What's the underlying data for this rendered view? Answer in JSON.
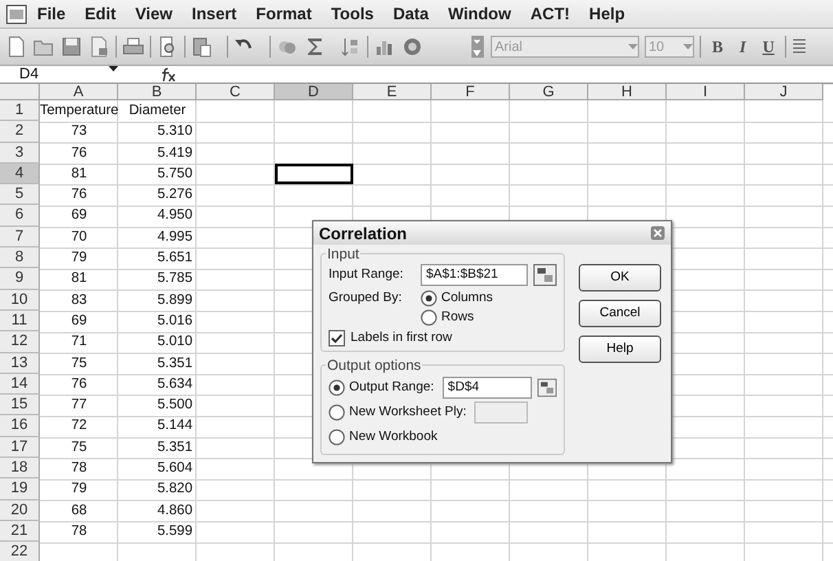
{
  "menu_bar": {
    "items": [
      "File",
      "Edit",
      "View",
      "Insert",
      "Format",
      "Tools",
      "Data",
      "Window",
      "ACT!",
      "Help"
    ]
  },
  "formatting_toolbar": {
    "font": "Arial",
    "size": "10",
    "buttons": [
      "B",
      "I",
      "U"
    ]
  },
  "formula_bar": {
    "name_box": "D4"
  },
  "sheet": {
    "columns": [
      {
        "label": "A",
        "selected": false
      },
      {
        "label": "B",
        "selected": false
      },
      {
        "label": "C",
        "selected": false
      },
      {
        "label": "D",
        "selected": true
      },
      {
        "label": "E",
        "selected": false
      },
      {
        "label": "F",
        "selected": false
      },
      {
        "label": "G",
        "selected": false
      },
      {
        "label": "H",
        "selected": false
      },
      {
        "label": "I",
        "selected": false
      },
      {
        "label": "J",
        "selected": false
      }
    ],
    "rows": [
      {
        "number": "1",
        "selected": false,
        "cells": [
          "Temperature",
          "Diameter"
        ]
      },
      {
        "number": "2",
        "selected": false,
        "cells": [
          "73",
          "5.310"
        ]
      },
      {
        "number": "3",
        "selected": false,
        "cells": [
          "76",
          "5.419"
        ]
      },
      {
        "number": "4",
        "selected": true,
        "cells": [
          "81",
          "5.750"
        ]
      },
      {
        "number": "5",
        "selected": false,
        "cells": [
          "76",
          "5.276"
        ]
      },
      {
        "number": "6",
        "selected": false,
        "cells": [
          "69",
          "4.950"
        ]
      },
      {
        "number": "7",
        "selected": false,
        "cells": [
          "70",
          "4.995"
        ]
      },
      {
        "number": "8",
        "selected": false,
        "cells": [
          "79",
          "5.651"
        ]
      },
      {
        "number": "9",
        "selected": false,
        "cells": [
          "81",
          "5.785"
        ]
      },
      {
        "number": "10",
        "selected": false,
        "cells": [
          "83",
          "5.899"
        ]
      },
      {
        "number": "11",
        "selected": false,
        "cells": [
          "69",
          "5.016"
        ]
      },
      {
        "number": "12",
        "selected": false,
        "cells": [
          "71",
          "5.010"
        ]
      },
      {
        "number": "13",
        "selected": false,
        "cells": [
          "75",
          "5.351"
        ]
      },
      {
        "number": "14",
        "selected": false,
        "cells": [
          "76",
          "5.634"
        ]
      },
      {
        "number": "15",
        "selected": false,
        "cells": [
          "77",
          "5.500"
        ]
      },
      {
        "number": "16",
        "selected": false,
        "cells": [
          "72",
          "5.144"
        ]
      },
      {
        "number": "17",
        "selected": false,
        "cells": [
          "75",
          "5.351"
        ]
      },
      {
        "number": "18",
        "selected": false,
        "cells": [
          "78",
          "5.604"
        ]
      },
      {
        "number": "19",
        "selected": false,
        "cells": [
          "79",
          "5.820"
        ]
      },
      {
        "number": "20",
        "selected": false,
        "cells": [
          "68",
          "4.860"
        ]
      },
      {
        "number": "21",
        "selected": false,
        "cells": [
          "78",
          "5.599"
        ]
      },
      {
        "number": "22",
        "selected": false,
        "cells": []
      }
    ]
  },
  "dialog": {
    "title": "Correlation",
    "input": {
      "legend": "Input",
      "input_range": {
        "label": "Input Range:",
        "value": "$A$1:$B$21"
      },
      "grouped_by": {
        "label": "Grouped By:",
        "options": [
          {
            "label": "Columns",
            "selected": true
          },
          {
            "label": "Rows",
            "selected": false
          }
        ]
      },
      "labels_checkbox": {
        "label": "Labels in first row",
        "checked": true
      }
    },
    "output": {
      "legend": "Output options",
      "options": [
        {
          "label": "Output Range:",
          "selected": true,
          "kind": "range",
          "value": "$D$4"
        },
        {
          "label": "New Worksheet Ply:",
          "selected": false,
          "kind": "field"
        },
        {
          "label": "New Workbook",
          "selected": false,
          "kind": "plain"
        }
      ]
    },
    "buttons": [
      "OK",
      "Cancel",
      "Help"
    ]
  }
}
